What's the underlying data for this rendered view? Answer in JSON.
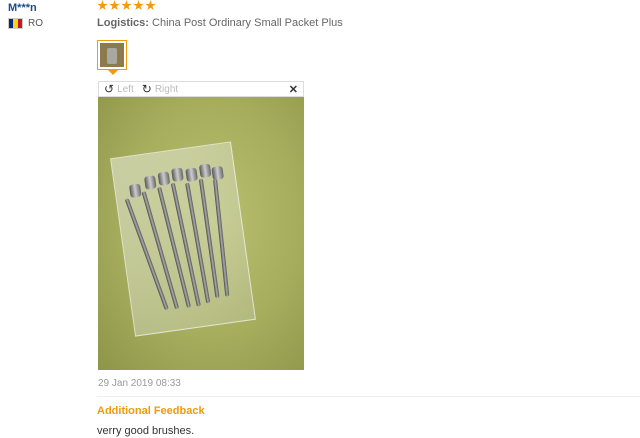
{
  "review": {
    "user_name": "M***n",
    "country": "RO",
    "rating": 5,
    "logistics_label": "Logistics:",
    "logistics_value": "China Post Ordinary Small Packet Plus",
    "date": "29 Jan 2019 08:33",
    "additional_feedback_label": "Additional Feedback",
    "additional_feedback_text": "verry good brushes."
  },
  "viewer": {
    "rotate_left_label": "Left",
    "rotate_right_label": "Right",
    "close_glyph": "✕"
  },
  "flag_colors": [
    "#002b7f",
    "#fcd116",
    "#ce1126"
  ],
  "accent_color": "#f29a0a"
}
